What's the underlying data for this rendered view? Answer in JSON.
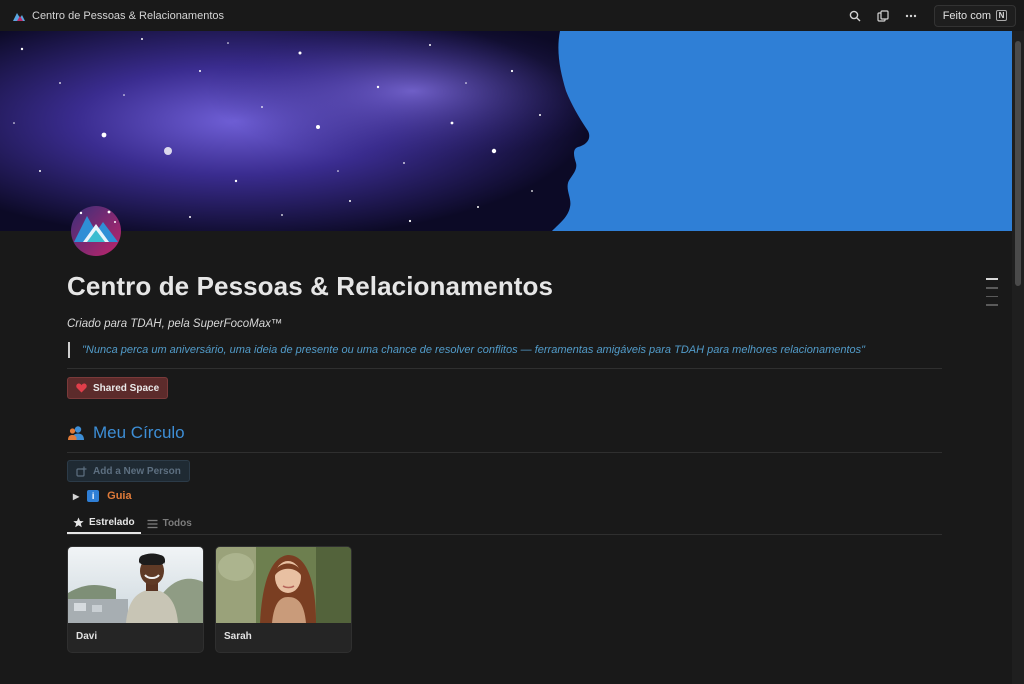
{
  "window": {
    "title": "Centro de Pessoas & Relacionamentos"
  },
  "topbar": {
    "made_with_label": "Feito com",
    "made_with_badge": "N",
    "icons": [
      "search-icon",
      "duplicate-icon",
      "more-icon"
    ]
  },
  "page": {
    "title": "Centro de Pessoas & Relacionamentos",
    "subtitle": "Criado para TDAH, pela SuperFocoMax™",
    "quote": "\"Nunca perca um aniversário, uma ideia de presente ou uma chance de resolver conflitos — ferramentas amigáveis para TDAH para melhores relacionamentos\"",
    "shared_space_label": "Shared Space"
  },
  "section": {
    "heading": "Meu Círculo",
    "add_button_label": "Add a New Person",
    "toggle_label": "Guia",
    "toggle_badge": "i"
  },
  "tabs": [
    {
      "label": "Estrelado",
      "icon": "star-icon",
      "active": true
    },
    {
      "label": "Todos",
      "icon": "list-icon",
      "active": false
    }
  ],
  "people": [
    {
      "name": "Davi"
    },
    {
      "name": "Sarah"
    }
  ],
  "colors": {
    "accent_blue": "#3d8ed6",
    "quote_blue": "#529cca",
    "guia_orange": "#e07b39",
    "cover_blue": "#2f7fd6",
    "shared_red": "#5c2b2b"
  }
}
